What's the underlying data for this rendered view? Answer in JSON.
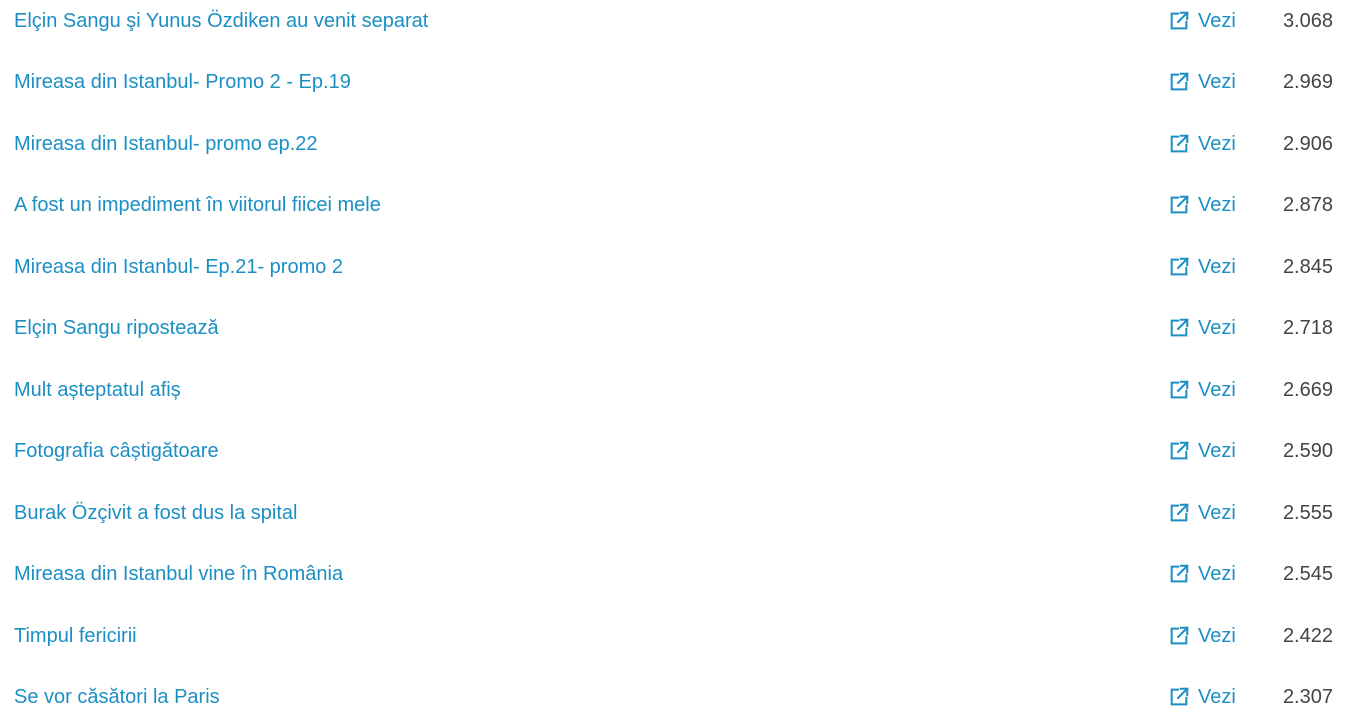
{
  "link_color": "#1b8fc4",
  "count_color": "#444444",
  "rows": [
    {
      "title": "Elçin Sangu şi Yunus Özdiken au venit separat",
      "action": "Vezi",
      "count": "3.068",
      "icon": "external-link-icon"
    },
    {
      "title": "Mireasa din Istanbul- Promo 2 - Ep.19",
      "action": "Vezi",
      "count": "2.969",
      "icon": "external-link-icon"
    },
    {
      "title": "Mireasa din Istanbul- promo ep.22",
      "action": "Vezi",
      "count": "2.906",
      "icon": "external-link-icon"
    },
    {
      "title": "A fost un impediment în viitorul fiicei mele",
      "action": "Vezi",
      "count": "2.878",
      "icon": "external-link-icon"
    },
    {
      "title": "Mireasa din Istanbul- Ep.21- promo 2",
      "action": "Vezi",
      "count": "2.845",
      "icon": "external-link-icon"
    },
    {
      "title": "Elçin Sangu ripostează",
      "action": "Vezi",
      "count": "2.718",
      "icon": "external-link-icon"
    },
    {
      "title": "Mult așteptatul afiș",
      "action": "Vezi",
      "count": "2.669",
      "icon": "external-link-icon"
    },
    {
      "title": "Fotografia câștigătoare",
      "action": "Vezi",
      "count": "2.590",
      "icon": "external-link-icon"
    },
    {
      "title": "Burak Özçivit a fost dus la spital",
      "action": "Vezi",
      "count": "2.555",
      "icon": "external-link-icon"
    },
    {
      "title": "Mireasa din Istanbul vine în România",
      "action": "Vezi",
      "count": "2.545",
      "icon": "external-link-icon"
    },
    {
      "title": "Timpul fericirii",
      "action": "Vezi",
      "count": "2.422",
      "icon": "external-link-icon"
    },
    {
      "title": "Se vor căsători la Paris",
      "action": "Vezi",
      "count": "2.307",
      "icon": "external-link-icon"
    }
  ]
}
